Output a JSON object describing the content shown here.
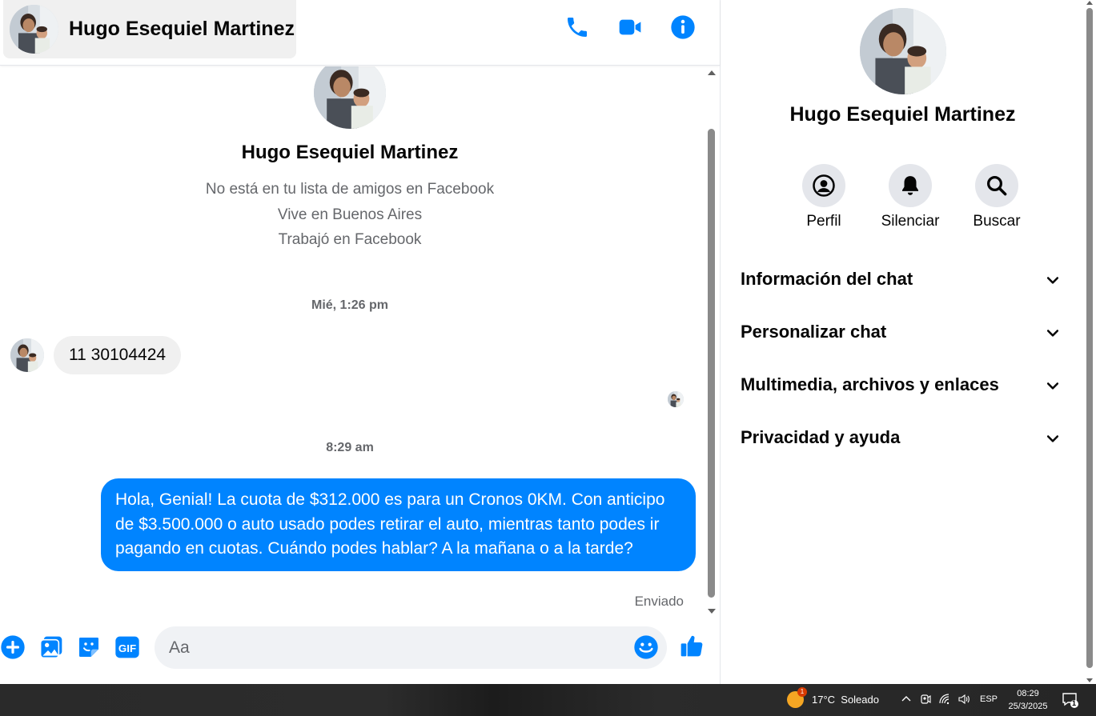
{
  "contact": {
    "name": "Hugo Esequiel Martinez",
    "info": [
      "No está en tu lista de amigos en Facebook",
      "Vive en Buenos Aires",
      "Trabajó en Facebook"
    ]
  },
  "messages": {
    "timestamp1": "Mié, 1:26 pm",
    "incoming_text": "11 30104424",
    "timestamp2": "8:29 am",
    "outgoing_text": "Hola, Genial! La cuota de $312.000 es para un Cronos 0KM. Con anticipo de $3.500.000 o auto usado podes retirar el auto, mientras tanto podes ir pagando en cuotas. Cuándo podes hablar? A la mañana o a la tarde?",
    "status": "Enviado"
  },
  "composer": {
    "placeholder": "Aa"
  },
  "info_panel": {
    "actions": [
      {
        "label": "Perfil",
        "icon": "profile-icon"
      },
      {
        "label": "Silenciar",
        "icon": "bell-icon"
      },
      {
        "label": "Buscar",
        "icon": "search-icon"
      }
    ],
    "sections": [
      "Información del chat",
      "Personalizar chat",
      "Multimedia, archivos y enlaces",
      "Privacidad y ayuda"
    ]
  },
  "colors": {
    "accent": "#0084ff",
    "bubble_in": "#f0f0f0",
    "secondary_text": "#65676b"
  },
  "taskbar": {
    "weather_badge": "1",
    "weather": "17°C  Soleado",
    "language": "ESP",
    "time": "08:29",
    "date": "25/3/2025",
    "notification_count": "1"
  }
}
